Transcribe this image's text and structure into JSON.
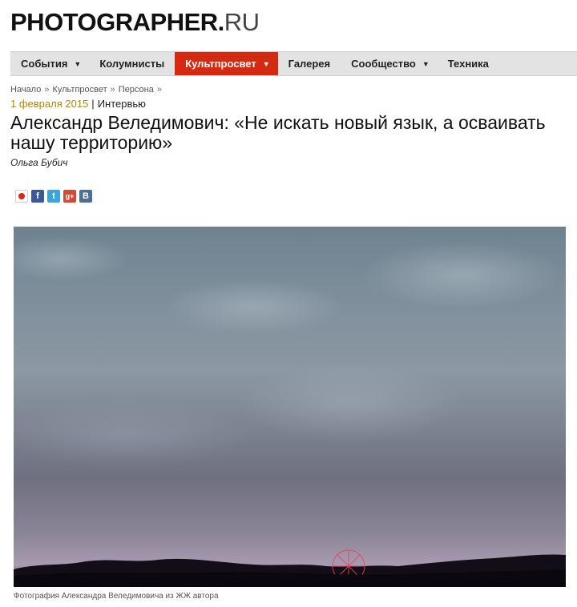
{
  "logo": {
    "brand": "PHOTOGRAPHER.",
    "tld": "RU"
  },
  "nav": {
    "items": [
      {
        "label": "События",
        "arrow": "▼"
      },
      {
        "label": "Колумнисты"
      },
      {
        "label": "Культпросвет",
        "arrow": "▼",
        "active": true
      },
      {
        "label": "Галерея"
      },
      {
        "label": "Сообщество",
        "arrow": "▼"
      },
      {
        "label": "Техника"
      }
    ],
    "active_color": "#d42a12"
  },
  "breadcrumb": {
    "items": [
      "Начало",
      "Культпросвет",
      "Персона"
    ],
    "separator": "»"
  },
  "article": {
    "date": "1 февраля 2015",
    "separator": "|",
    "type": "Интервью",
    "title": "Александр Веледимович: «Не искать новый язык, а осваивать нашу территорию»",
    "author": "Ольга Бубич",
    "photo_caption": "Фотография Александра Веледимовича из ЖЖ автора"
  },
  "share": {
    "icons": [
      {
        "name": "mail-icon",
        "glyph": ""
      },
      {
        "name": "facebook-icon",
        "glyph": "f"
      },
      {
        "name": "twitter-icon",
        "glyph": "t"
      },
      {
        "name": "google-plus-icon",
        "glyph": "g+"
      },
      {
        "name": "vkontakte-icon",
        "glyph": "B"
      }
    ]
  }
}
